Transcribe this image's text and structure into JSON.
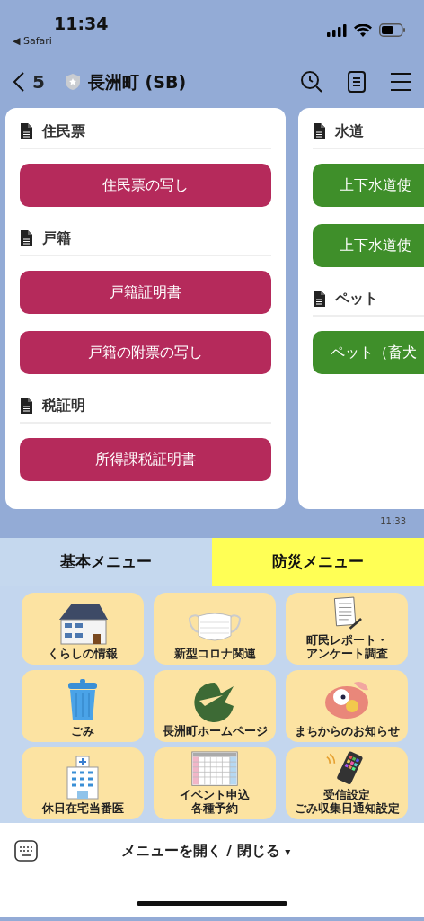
{
  "status_bar": {
    "time": "11:34",
    "back_app": "◀ Safari"
  },
  "header": {
    "back_count": "5",
    "title": "長洲町 (SB)"
  },
  "cards": [
    {
      "color": "#b52a5b",
      "sections": [
        {
          "title": "住民票",
          "buttons": [
            "住民票の写し"
          ]
        },
        {
          "title": "戸籍",
          "buttons": [
            "戸籍証明書",
            "戸籍の附票の写し"
          ]
        },
        {
          "title": "税証明",
          "buttons": [
            "所得課税証明書"
          ]
        }
      ]
    },
    {
      "color": "#3f8f2a",
      "sections": [
        {
          "title": "水道",
          "buttons": [
            "上下水道使",
            "上下水道使"
          ]
        },
        {
          "title": "ペット",
          "buttons": [
            "ペット（畜犬"
          ]
        }
      ]
    }
  ],
  "message_time": "11:33",
  "rich_menu": {
    "tabs": [
      {
        "label": "基本メニュー",
        "color": "#c5d8ee"
      },
      {
        "label": "防災メニュー",
        "color": "#ffff55"
      }
    ],
    "tiles": [
      {
        "lines": [
          "くらしの情報"
        ]
      },
      {
        "lines": [
          "新型コロナ関連"
        ]
      },
      {
        "lines": [
          "町民レポート・",
          "アンケート調査"
        ]
      },
      {
        "lines": [
          "ごみ"
        ]
      },
      {
        "lines": [
          "長洲町ホームページ"
        ]
      },
      {
        "lines": [
          "まちからのお知らせ"
        ]
      },
      {
        "lines": [
          "休日在宅当番医"
        ]
      },
      {
        "lines": [
          "イベント申込",
          "各種予約"
        ]
      },
      {
        "lines": [
          "受信設定",
          "ごみ収集日通知設定"
        ]
      }
    ]
  },
  "footer": {
    "toggle": "メニューを開く / 閉じる",
    "caret": "▾"
  }
}
